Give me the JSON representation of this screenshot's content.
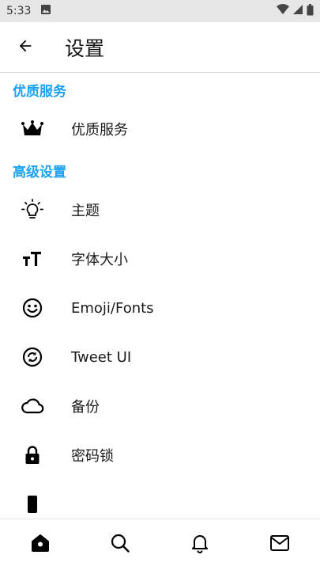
{
  "status_bar": {
    "time": "5:33",
    "icons": [
      "image-notification-icon",
      "wifi-icon",
      "signal-icon",
      "battery-icon"
    ]
  },
  "app_bar": {
    "title": "设置",
    "back_icon": "arrow-left-icon"
  },
  "sections": [
    {
      "title": "优质服务",
      "items": [
        {
          "label": "优质服务",
          "icon": "crown-icon"
        }
      ]
    },
    {
      "title": "高级设置",
      "items": [
        {
          "label": "主题",
          "icon": "lightbulb-icon"
        },
        {
          "label": "字体大小",
          "icon": "text-size-icon"
        },
        {
          "label": "Emoji/Fonts",
          "icon": "smiley-icon"
        },
        {
          "label": "Tweet UI",
          "icon": "sync-circle-icon"
        },
        {
          "label": "备份",
          "icon": "cloud-icon"
        },
        {
          "label": "密码锁",
          "icon": "lock-icon"
        }
      ]
    }
  ],
  "bottom_nav": [
    {
      "name": "home",
      "icon": "home-icon",
      "active": true
    },
    {
      "name": "search",
      "icon": "search-icon",
      "active": false
    },
    {
      "name": "notifications",
      "icon": "bell-icon",
      "active": false
    },
    {
      "name": "messages",
      "icon": "mail-icon",
      "active": false
    }
  ],
  "colors": {
    "accent": "#1da1f2",
    "status_bar_bg": "#e6e6e6",
    "text_primary": "#111111"
  }
}
